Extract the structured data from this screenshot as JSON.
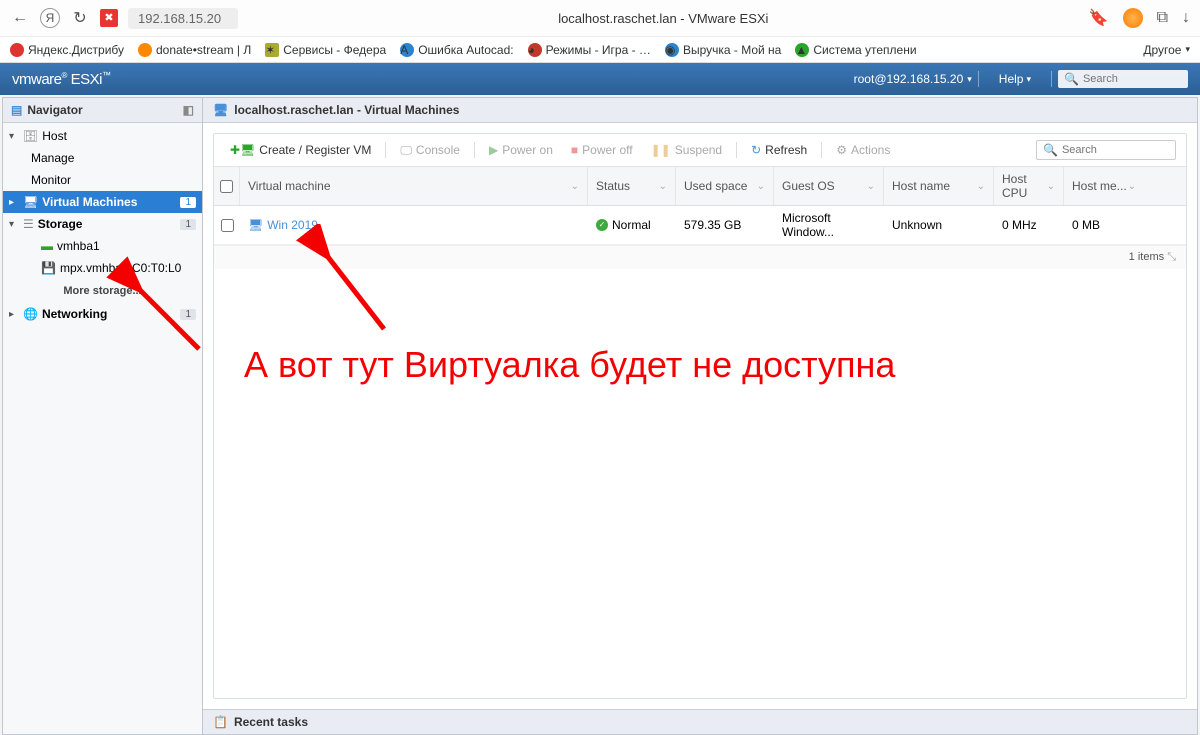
{
  "browser": {
    "url": "192.168.15.20",
    "page_title": "localhost.raschet.lan - VMware ESXi",
    "bookmarks": [
      {
        "label": "Яндекс.Дистрибу",
        "color": "#d33"
      },
      {
        "label": "donate•stream | Л",
        "color": "#f80"
      },
      {
        "label": "Сервисы - Федера",
        "color": "#aa3"
      },
      {
        "label": "Ошибка Autocad:",
        "color": "#2c83cf"
      },
      {
        "label": "Режимы - Игра - …",
        "color": "#c0392b"
      },
      {
        "label": "Выручка - Мой на",
        "color": "#2c83cf"
      },
      {
        "label": "Система утеплени",
        "color": "#2aa52a"
      }
    ],
    "other": "Другое"
  },
  "header": {
    "product": "vmware ESXi",
    "user": "root@192.168.15.20",
    "help": "Help",
    "search_placeholder": "Search"
  },
  "navigator": {
    "title": "Navigator",
    "items": {
      "host": "Host",
      "manage": "Manage",
      "monitor": "Monitor",
      "vms": "Virtual Machines",
      "vms_count": "1",
      "storage": "Storage",
      "storage_count": "1",
      "ds1": "vmhba1",
      "ds2": "mpx.vmhba1:C0:T0:L0",
      "more_storage": "More storage...",
      "networking": "Networking",
      "net_count": "1"
    }
  },
  "main": {
    "breadcrumb": "localhost.raschet.lan - Virtual Machines",
    "toolbar": {
      "create": "Create / Register VM",
      "console": "Console",
      "power_on": "Power on",
      "power_off": "Power off",
      "suspend": "Suspend",
      "refresh": "Refresh",
      "actions": "Actions",
      "search_placeholder": "Search"
    },
    "columns": {
      "vm": "Virtual machine",
      "status": "Status",
      "used": "Used space",
      "guest": "Guest OS",
      "hostname": "Host name",
      "cpu": "Host CPU",
      "mem": "Host me..."
    },
    "row": {
      "vm": "Win 2019",
      "status": "Normal",
      "used": "579.35 GB",
      "guest": "Microsoft Window...",
      "hostname": "Unknown",
      "cpu": "0 MHz",
      "mem": "0 MB"
    },
    "footer": "1 items"
  },
  "annotation": "А вот тут Виртуалка будет не доступна",
  "recent_tasks": "Recent tasks"
}
